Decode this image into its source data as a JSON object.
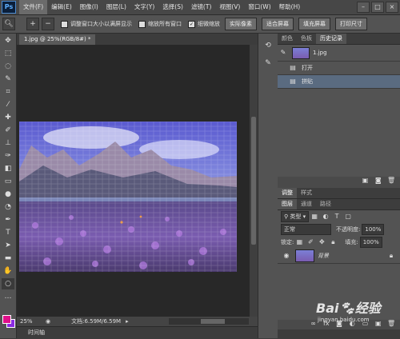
{
  "app": {
    "logo": "Ps"
  },
  "menu": [
    "文件(F)",
    "编辑(E)",
    "图像(I)",
    "图层(L)",
    "文字(Y)",
    "选择(S)",
    "滤镜(T)",
    "视图(V)",
    "窗口(W)",
    "帮助(H)"
  ],
  "window_controls": [
    "–",
    "□",
    "×"
  ],
  "options": {
    "check1": "调整窗口大小以满屏显示",
    "check2": "缩放所有窗口",
    "check3": "细微缩放",
    "btn_actual": "实际像素",
    "btn_fit": "适合屏幕",
    "btn_fill": "填充屏幕",
    "btn_print": "打印尺寸"
  },
  "document": {
    "tab_title": "1.jpg @ 25%(RGB/8#) *",
    "zoom": "25%",
    "doc_info": "文档:6.59M/6.59M"
  },
  "timeline_label": "时间轴",
  "panels": {
    "top_tabs": [
      "颜色",
      "色板",
      "历史记录"
    ],
    "history_snapshot": "1.jpg",
    "history_items": [
      "打开",
      "拼贴"
    ],
    "adjust_tabs": [
      "调整",
      "样式"
    ],
    "layer_tabs": [
      "图层",
      "通道",
      "路径"
    ],
    "kind_label": "类型",
    "blend_mode": "正常",
    "opacity_label": "不透明度:",
    "opacity_value": "100%",
    "lock_label": "锁定:",
    "fill_label": "填充:",
    "fill_value": "100%",
    "layer_name": "背景"
  },
  "watermark": {
    "brand": "Bai",
    "brand2": "经验",
    "url": "jingyan.baidu.com"
  },
  "colors": {
    "accent": "#5a6b80",
    "fg_swatch": "#e0108a",
    "bg_swatch": "#8a2be2"
  }
}
